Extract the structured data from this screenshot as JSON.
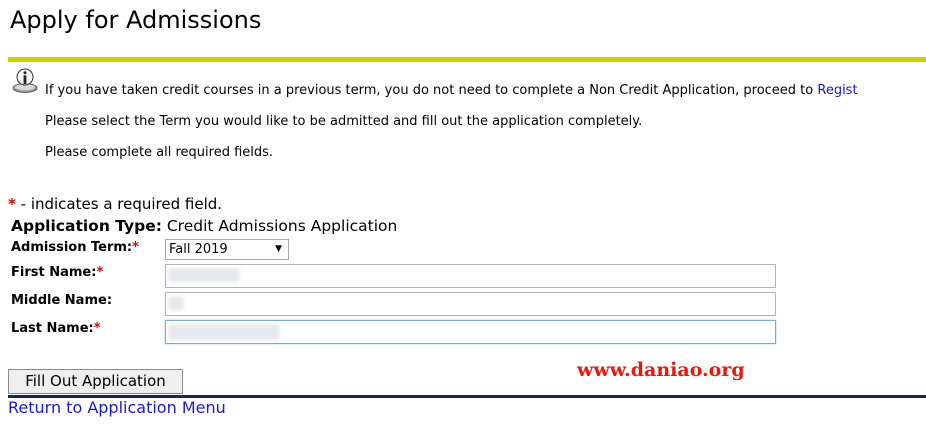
{
  "page": {
    "title": "Apply for Admissions"
  },
  "info": {
    "line1_text": "If you have taken credit courses in a previous term, you do not need to complete a Non Credit Application, proceed to ",
    "line1_link": "Regist",
    "line2": "Please select the Term you would like to be admitted and fill out the application completely.",
    "line3": "Please complete all required fields."
  },
  "required_note": {
    "marker": "*",
    "text": "- indicates a required field."
  },
  "application_type": {
    "label": "Application Type:",
    "value": "Credit Admissions Application"
  },
  "form": {
    "admission_term": {
      "label": "Admission Term:",
      "required_marker": "*",
      "selected": "Fall 2019"
    },
    "first_name": {
      "label": "First Name:",
      "required_marker": "*",
      "value": ""
    },
    "middle_name": {
      "label": "Middle Name:",
      "value": ""
    },
    "last_name": {
      "label": "Last Name:",
      "required_marker": "*",
      "value": ""
    }
  },
  "actions": {
    "fill_out_button": "Fill Out Application",
    "return_link": "Return to Application Menu"
  },
  "watermark": "www.daniao.org",
  "colors": {
    "title_rule": "#d4ce00",
    "footer_rule": "#0d2a5c",
    "link": "#1a1acd",
    "required_star": "#e00000",
    "watermark": "#e8180c"
  },
  "icons": {
    "info": "info-icon",
    "dropdown": "chevron-down-icon"
  }
}
